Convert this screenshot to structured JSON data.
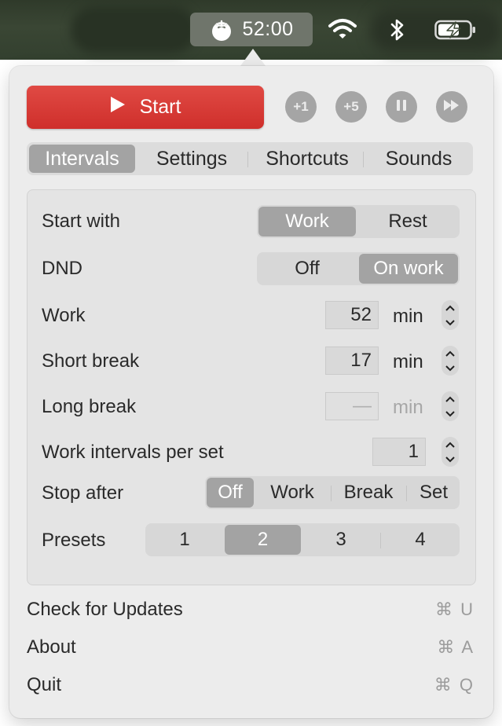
{
  "menubar": {
    "timer_text": "52:00",
    "icons": [
      "tomato-icon",
      "wifi-icon",
      "bluetooth-icon",
      "battery-charging-icon"
    ]
  },
  "controls": {
    "start_label": "Start",
    "plus1_label": "+1",
    "plus5_label": "+5",
    "pause_icon": "pause-icon",
    "skip_icon": "skip-forward-icon"
  },
  "tabs": [
    {
      "label": "Intervals",
      "active": true
    },
    {
      "label": "Settings",
      "active": false
    },
    {
      "label": "Shortcuts",
      "active": false
    },
    {
      "label": "Sounds",
      "active": false
    }
  ],
  "intervals": {
    "start_with": {
      "label": "Start with",
      "options": [
        "Work",
        "Rest"
      ],
      "selected": "Work"
    },
    "dnd": {
      "label": "DND",
      "options": [
        "Off",
        "On work"
      ],
      "selected": "On work"
    },
    "work": {
      "label": "Work",
      "value": "52",
      "unit": "min"
    },
    "short_break": {
      "label": "Short break",
      "value": "17",
      "unit": "min"
    },
    "long_break": {
      "label": "Long break",
      "value": "—",
      "unit": "min"
    },
    "work_intervals": {
      "label": "Work intervals per set",
      "value": "1"
    },
    "stop_after": {
      "label": "Stop after",
      "options": [
        "Off",
        "Work",
        "Break",
        "Set"
      ],
      "selected": "Off"
    },
    "presets": {
      "label": "Presets",
      "options": [
        "1",
        "2",
        "3",
        "4"
      ],
      "selected": "2"
    }
  },
  "menu": [
    {
      "label": "Check for Updates",
      "shortcut": "⌘ U"
    },
    {
      "label": "About",
      "shortcut": "⌘ A"
    },
    {
      "label": "Quit",
      "shortcut": "⌘ Q"
    }
  ],
  "colors": {
    "accent_red": "#d83a35",
    "selected_gray": "#a3a3a3",
    "panel_bg": "#ececec"
  }
}
